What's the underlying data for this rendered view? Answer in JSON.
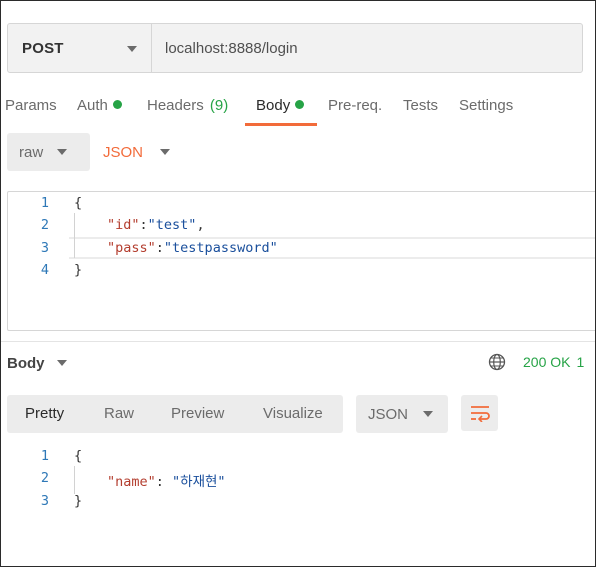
{
  "request": {
    "method": "POST",
    "url": "localhost:8888/login"
  },
  "tabs": {
    "params": "Params",
    "auth": "Auth",
    "headers": "Headers",
    "headers_count": "(9)",
    "body": "Body",
    "prereq": "Pre-req.",
    "tests": "Tests",
    "settings": "Settings",
    "active": "Body",
    "indicator_color": "#26a346"
  },
  "body_options": {
    "mode": "raw",
    "language": "JSON"
  },
  "request_body": {
    "line_numbers": [
      "1",
      "2",
      "3",
      "4"
    ],
    "open": "{",
    "close": "}",
    "fields": [
      {
        "key": "\"id\"",
        "sep": ":",
        "value": "\"test\"",
        "trail": ","
      },
      {
        "key": "\"pass\"",
        "sep": ":",
        "value": "\"testpassword\"",
        "trail": ""
      }
    ]
  },
  "response": {
    "title": "Body",
    "status": "200 OK",
    "status_extra": "1",
    "status_color": "#26a346",
    "view_modes": [
      "Pretty",
      "Raw",
      "Preview",
      "Visualize"
    ],
    "selected_view": "Pretty",
    "format": "JSON",
    "line_numbers": [
      "1",
      "2",
      "3"
    ],
    "open": "{",
    "close": "}",
    "fields": [
      {
        "key": "\"name\"",
        "sep": ": ",
        "value": "\"하재현\""
      }
    ]
  },
  "icons": [
    "chevron-down-icon",
    "globe-icon",
    "wrap-lines-icon"
  ],
  "colors": {
    "accent": "#f26b3a",
    "success": "#26a346",
    "line_number": "#2e78b7"
  }
}
